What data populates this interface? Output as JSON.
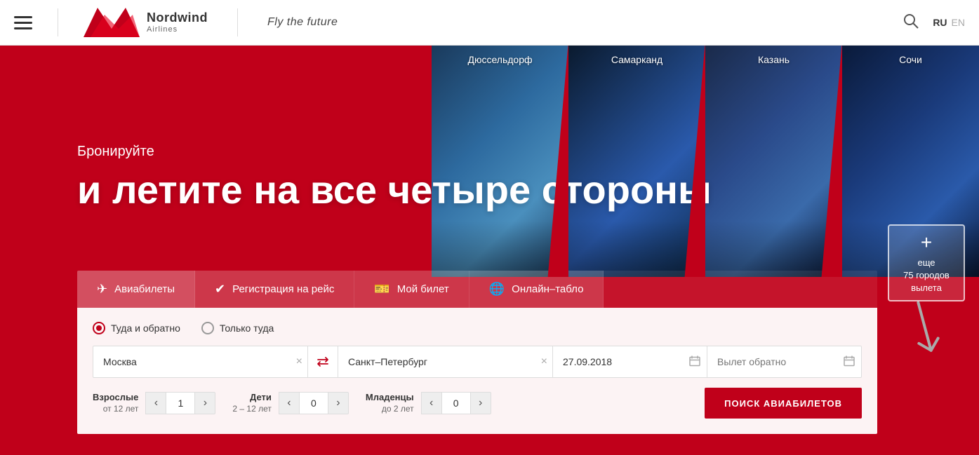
{
  "header": {
    "logo_main": "Nordwind",
    "logo_sub": "Airlines",
    "slogan": "Fly the future",
    "lang_ru": "RU",
    "lang_en": "EN"
  },
  "hero": {
    "subtitle": "Бронируйте",
    "title": "и летите на все четыре стороны",
    "cities": [
      {
        "name": "Дюссельдорф",
        "class": "city-dusseldorf"
      },
      {
        "name": "Самарканд",
        "class": "city-samarkand"
      },
      {
        "name": "Казань",
        "class": "city-kazan"
      },
      {
        "name": "Сочи",
        "class": "city-sochi"
      }
    ],
    "more_cities_count": "75 городов",
    "more_cities_label": "вылета"
  },
  "tabs": [
    {
      "id": "tickets",
      "label": "Авиабилеты",
      "active": true
    },
    {
      "id": "checkin",
      "label": "Регистрация на рейс",
      "active": false
    },
    {
      "id": "mybillet",
      "label": "Мой билет",
      "active": false
    },
    {
      "id": "board",
      "label": "Онлайн–табло",
      "active": false
    }
  ],
  "form": {
    "radio_roundtrip": "Туда и обратно",
    "radio_oneway": "Только туда",
    "from_value": "Москва",
    "to_value": "Санкт–Петербург",
    "date_value": "27.09.2018",
    "date_return_placeholder": "Вылет обратно",
    "adults_label": "Взрослые",
    "adults_sublabel": "от 12 лет",
    "adults_value": "1",
    "children_label": "Дети",
    "children_sublabel": "2 – 12 лет",
    "children_value": "0",
    "infants_label": "Младенцы",
    "infants_sublabel": "до 2 лет",
    "infants_value": "0",
    "search_btn": "ПОИСК АВИАБИЛЕТОВ"
  },
  "icons": {
    "hamburger": "☰",
    "search": "🔍",
    "swap": "⇄",
    "calendar": "⊞",
    "plane": "✈",
    "ticket_check": "☑",
    "suitcase": "🧳",
    "globe": "🌐",
    "plus": "+"
  }
}
